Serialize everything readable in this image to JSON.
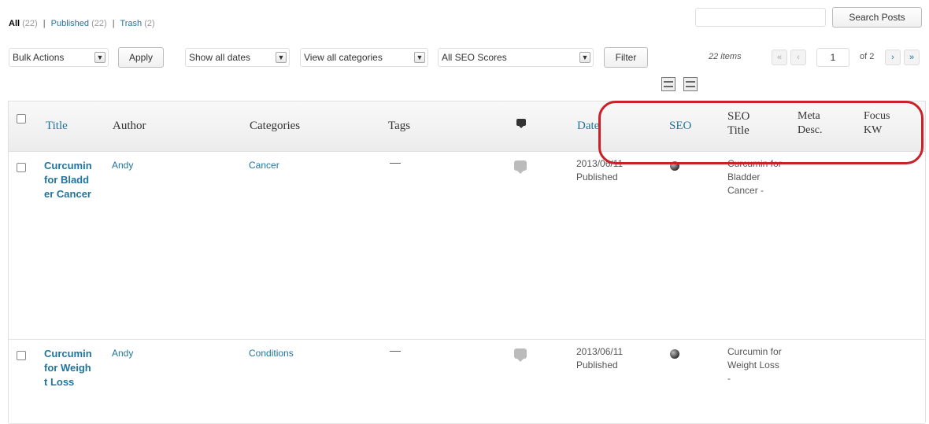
{
  "status_links": {
    "all_label": "All",
    "all_count": "(22)",
    "published_label": "Published",
    "published_count": "(22)",
    "trash_label": "Trash",
    "trash_count": "(2)",
    "separator": "|"
  },
  "search": {
    "input_value": "",
    "button_label": "Search Posts"
  },
  "toolbar": {
    "bulk_actions": "Bulk Actions",
    "apply_label": "Apply",
    "dates_filter": "Show all dates",
    "categories_filter": "View all categories",
    "seo_filter": "All SEO Scores",
    "filter_label": "Filter"
  },
  "pagination": {
    "items": "22 items",
    "first": "«",
    "prev": "‹",
    "current_page": "1",
    "of_pages": "of 2",
    "next": "›",
    "last": "»"
  },
  "table": {
    "headers": {
      "title": "Title",
      "author": "Author",
      "categories": "Categories",
      "tags": "Tags",
      "date": "Date",
      "seo": "SEO",
      "seo_title_1": "SEO",
      "seo_title_2": "Title",
      "meta_1": "Meta",
      "meta_2": "Desc.",
      "focus_1": "Focus",
      "focus_2": "KW"
    },
    "rows": [
      {
        "title": "Curcumin for Bladder Cancer",
        "author": "Andy",
        "category": "Cancer",
        "tags": "—",
        "date": "2013/06/11",
        "status": "Published",
        "seo_title": "Curcumin for Bladder Cancer -"
      },
      {
        "title": "Curcumin for Weight Loss",
        "author": "Andy",
        "category": "Conditions",
        "tags": "—",
        "date": "2013/06/11",
        "status": "Published",
        "seo_title": "Curcumin for Weight Loss -"
      }
    ]
  },
  "colors": {
    "link": "#21759b",
    "highlight": "#cc2029"
  },
  "icons": [
    "chevron-down-icon",
    "comment-icon",
    "seo-score-icon",
    "list-view-icon",
    "excerpt-view-icon"
  ]
}
